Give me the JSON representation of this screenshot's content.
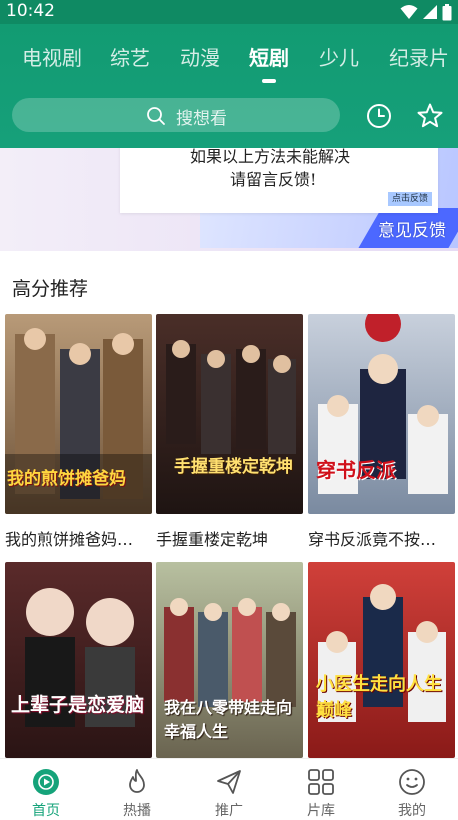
{
  "status_bar": {
    "time": "10:42"
  },
  "tabs": [
    {
      "label": "电视剧"
    },
    {
      "label": "综艺"
    },
    {
      "label": "动漫"
    },
    {
      "label": "短剧",
      "active": true
    },
    {
      "label": "少儿"
    },
    {
      "label": "纪录片"
    }
  ],
  "search": {
    "placeholder": "搜想看"
  },
  "banner": {
    "line1": "如果以上方法未能解决",
    "line2": "请留言反馈!",
    "button": "点击反馈",
    "caption": "意见反馈"
  },
  "section": {
    "title": "高分推荐",
    "cards": [
      {
        "title": "我的煎饼摊爸妈…",
        "poster_text": "我的煎饼摊爸妈"
      },
      {
        "title": "手握重楼定乾坤",
        "poster_text": "手握重楼定乾坤"
      },
      {
        "title": "穿书反派竟不按…",
        "poster_text": "穿书反派"
      },
      {
        "title": "",
        "poster_text": "上辈子是恋爱脑"
      },
      {
        "title": "",
        "poster_text": "我在八零带娃走向幸福人生"
      },
      {
        "title": "",
        "poster_text": "小医生走向人生巅峰"
      }
    ]
  },
  "bottom_nav": [
    {
      "label": "首页",
      "icon": "play-circle-icon",
      "active": true
    },
    {
      "label": "热播",
      "icon": "flame-icon"
    },
    {
      "label": "推广",
      "icon": "paper-plane-icon"
    },
    {
      "label": "片库",
      "icon": "grid-icon"
    },
    {
      "label": "我的",
      "icon": "smile-icon"
    }
  ],
  "colors": {
    "header": "#129b72",
    "accent": "#15a37a"
  }
}
